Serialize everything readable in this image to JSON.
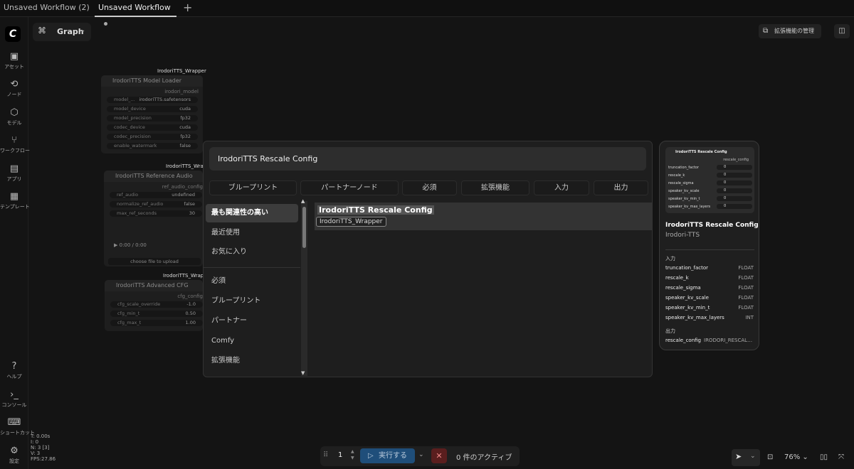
{
  "tabs": [
    {
      "label": "Unsaved Workflow (2)",
      "active": false
    },
    {
      "label": "Unsaved Workflow",
      "active": true
    }
  ],
  "sidebar": {
    "items": [
      {
        "label": "アセット",
        "icon": "image-icon"
      },
      {
        "label": "ノード",
        "icon": "node-icon"
      },
      {
        "label": "モデル",
        "icon": "cube-icon"
      },
      {
        "label": "ワークフロー",
        "icon": "workflow-icon"
      },
      {
        "label": "アプリ",
        "icon": "app-icon"
      },
      {
        "label": "テンプレート",
        "icon": "template-icon"
      }
    ],
    "bottom": [
      {
        "label": "ヘルプ",
        "icon": "help-icon"
      },
      {
        "label": "コンソール",
        "icon": "terminal-icon"
      },
      {
        "label": "ショートカット",
        "icon": "keyboard-icon"
      },
      {
        "label": "設定",
        "icon": "gear-icon"
      }
    ]
  },
  "stats": [
    "T: 0.00s",
    "I: 0",
    "N: 3 [3]",
    "V: 3",
    "FPS:27.86"
  ],
  "header": {
    "graph_label": "Graph",
    "extensions_label": "拡張機能の管理"
  },
  "nodes": {
    "wrapper_label": "IrodoriTTS_Wrapper",
    "loader": {
      "title": "IrodoriTTS Model Loader",
      "output": "irodori_model",
      "widgets": [
        [
          "model_...",
          "irodoriTTS.safetensors"
        ],
        [
          "model_device",
          "cuda"
        ],
        [
          "model_precision",
          "fp32"
        ],
        [
          "codec_device",
          "cuda"
        ],
        [
          "codec_precision",
          "fp32"
        ],
        [
          "enable_watermark",
          "false"
        ]
      ]
    },
    "wrapper_label_short": "IrodoriTTS_Wrapp",
    "ref": {
      "title": "IrodoriTTS Reference Audio",
      "output": "ref_audio_config",
      "widgets": [
        [
          "ref_audio",
          "undefined"
        ],
        [
          "normalize_ref_audio",
          "false"
        ],
        [
          "max_ref_seconds",
          "30"
        ]
      ],
      "audio_time": "0:00 / 0:00",
      "upload": "choose file to upload"
    },
    "cfg": {
      "title": "IrodoriTTS Advanced CFG",
      "output": "cfg_config",
      "widgets": [
        [
          "cfg_scale_override",
          "-1.0"
        ],
        [
          "cfg_min_t",
          "0.50"
        ],
        [
          "cfg_max_t",
          "1.00"
        ]
      ]
    }
  },
  "search": {
    "query": "IrodoriTTS Rescale Config",
    "filters": [
      "ブループリント",
      "パートナーノード",
      "必須",
      "拡張機能",
      "入力",
      "出力"
    ],
    "categories": [
      "最も関連性の高い",
      "最近使用",
      "お気に入り",
      "必須",
      "ブループリント",
      "パートナー",
      "Comfy",
      "拡張機能"
    ],
    "result": {
      "title": "IrodoriTTS Rescale Config",
      "source": "IrodoriTTS_Wrapper"
    }
  },
  "preview": {
    "mini_title": "IrodoriTTS Rescale Config",
    "mini_output": "rescale_config",
    "mini_rows": [
      [
        "truncation_factor",
        "0"
      ],
      [
        "rescale_k",
        "0"
      ],
      [
        "rescale_sigma",
        "0"
      ],
      [
        "speaker_kv_scale",
        "0"
      ],
      [
        "speaker_kv_min_t",
        "0"
      ],
      [
        "speaker_kv_max_layers",
        "0"
      ]
    ],
    "title": "IrodoriTTS Rescale Config",
    "subtitle": "Irodori-TTS",
    "inputs_label": "入力",
    "inputs": [
      [
        "truncation_factor",
        "FLOAT"
      ],
      [
        "rescale_k",
        "FLOAT"
      ],
      [
        "rescale_sigma",
        "FLOAT"
      ],
      [
        "speaker_kv_scale",
        "FLOAT"
      ],
      [
        "speaker_kv_min_t",
        "FLOAT"
      ],
      [
        "speaker_kv_max_layers",
        "INT"
      ]
    ],
    "outputs_label": "出力",
    "outputs": [
      [
        "rescale_config",
        "IRODORI_RESCALE_CONFIG"
      ]
    ]
  },
  "runbar": {
    "count": "1",
    "run_label": "実行する",
    "queue_label": "0 件のアクティブ"
  },
  "zoom": "76%"
}
